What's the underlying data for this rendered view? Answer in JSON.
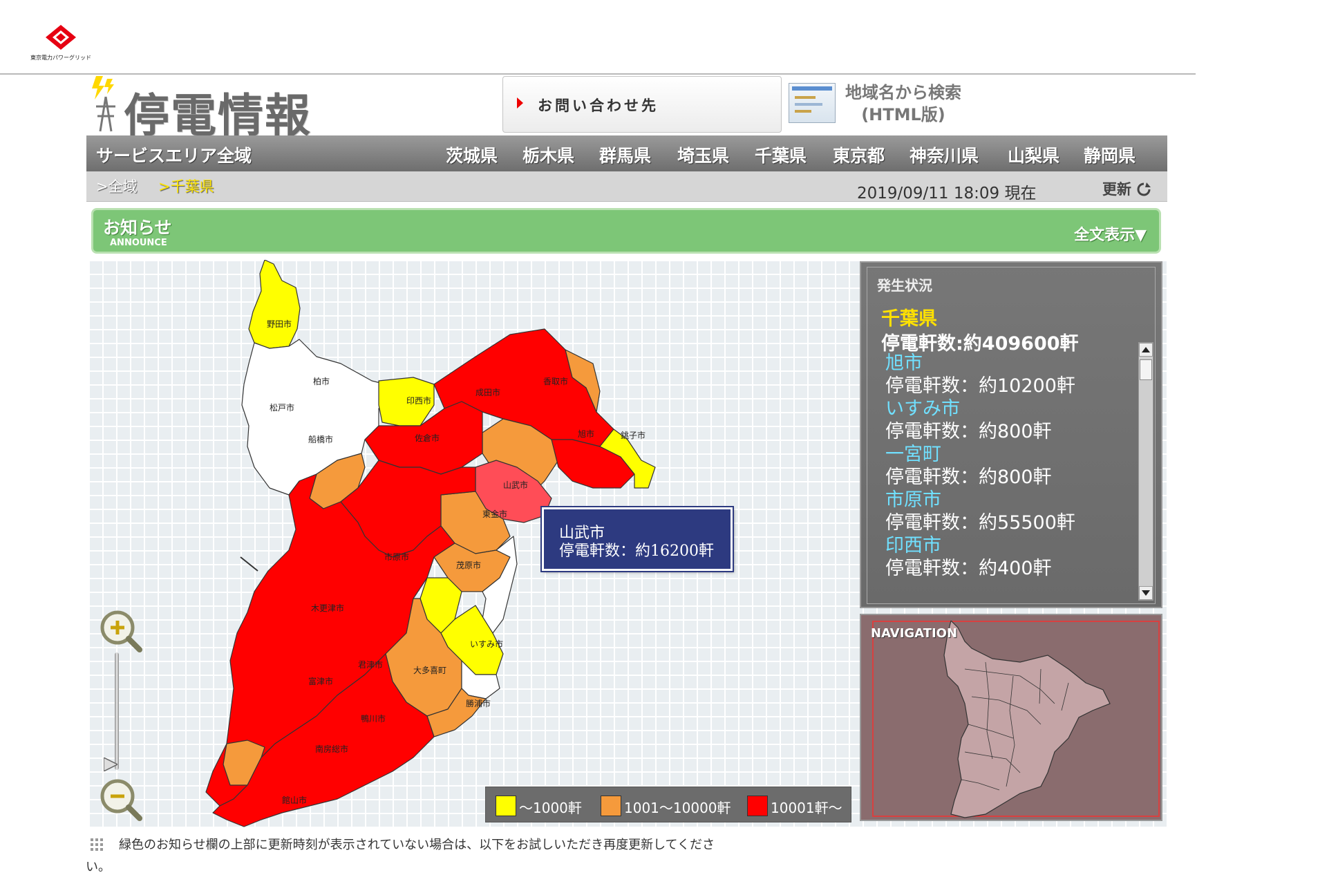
{
  "header": {
    "logo_caption": "東京電力パワーグリッド",
    "title": "停電情報",
    "contact_label": "お問い合わせ先",
    "search_label_1": "地域名から検索",
    "search_label_2": "(HTML版)"
  },
  "nav": {
    "all_area": "サービスエリア全域",
    "prefectures": [
      "茨城県",
      "栃木県",
      "群馬県",
      "埼玉県",
      "千葉県",
      "東京都",
      "神奈川県",
      "山梨県",
      "静岡県"
    ]
  },
  "breadcrumb": {
    "root": ">全域",
    "current": ">千葉県"
  },
  "timestamp": "2019/09/11 18:09 現在",
  "refresh_label": "更新",
  "announce": {
    "title": "お知らせ",
    "subtitle": "ANNOUNCE",
    "full_text": "全文表示▼"
  },
  "tooltip": {
    "city": "山武市",
    "count": "停電軒数：約16200軒"
  },
  "legend": [
    {
      "label": "〜1000軒",
      "color": "#ffff00"
    },
    {
      "label": "1001〜10000軒",
      "color": "#f59a3c"
    },
    {
      "label": "10001軒〜",
      "color": "#ff0000"
    }
  ],
  "status": {
    "heading": "発生状況",
    "prefecture": "千葉県",
    "total": "停電軒数:約409600軒",
    "items": [
      {
        "city": "旭市",
        "count": "停電軒数：約10200軒"
      },
      {
        "city": "いすみ市",
        "count": "停電軒数：約800軒"
      },
      {
        "city": "一宮町",
        "count": "停電軒数：約800軒"
      },
      {
        "city": "市原市",
        "count": "停電軒数：約55500軒"
      },
      {
        "city": "印西市",
        "count": "停電軒数：約400軒"
      }
    ]
  },
  "navigation": {
    "title": "NAVIGATION"
  },
  "map_labels": {
    "noda": "野田市",
    "kashiwa": "柏市",
    "matsudo": "松戸市",
    "funabashi": "船橋市",
    "inzai": "印西市",
    "narita": "成田市",
    "katori": "香取市",
    "sakura": "佐倉市",
    "asahi": "旭市",
    "choshi": "銚子市",
    "sammu": "山武市",
    "togane": "東金市",
    "ichihara": "市原市",
    "mobara": "茂原市",
    "kisarazu": "木更津市",
    "kimitsu": "君津市",
    "futtsu": "富津市",
    "isumi": "いすみ市",
    "otaki": "大多喜町",
    "katsuura": "勝浦市",
    "kamogawa": "鴨川市",
    "minamiboso": "南房総市",
    "tateyama": "館山市"
  },
  "footer": {
    "note": "緑色のお知らせ欄の上部に更新時刻が表示されていない場合は、以下をお試しいただき再度更新してくださ",
    "note_cont": "い。"
  }
}
